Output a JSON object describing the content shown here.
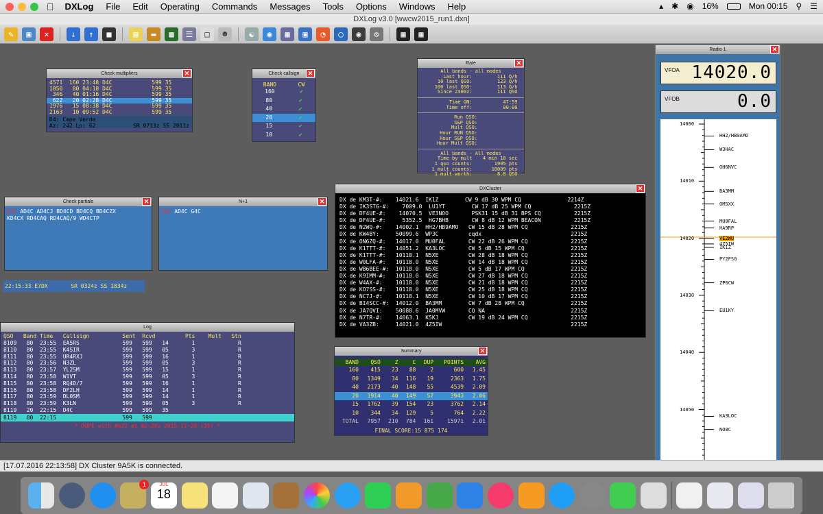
{
  "menubar": {
    "app": "DXLog",
    "items": [
      "File",
      "Edit",
      "Operating",
      "Commands",
      "Messages",
      "Tools",
      "Options",
      "Windows",
      "Help"
    ],
    "battery": "16%",
    "clock": "Mon 00:15"
  },
  "window": {
    "title": "DXLog v3.0 [wwcw2015_run1.dxn]"
  },
  "check_mult": {
    "title": "Check multipliers",
    "rows": [
      "4571  160 23:48 D4C            599 35",
      "1050   80 04:18 D4C            599 35",
      " 346   40 01:16 D4C            599 35",
      " 622   20 02:28 D4C            599 35",
      "1976   15 08:38 D4C            599 35",
      "2163   10 09:52 D4C            599 35"
    ],
    "info1": "D4: Cape Verde",
    "info2": "Az: 242  Lp: 62",
    "info3": "SR 0713z  SS 2011z"
  },
  "check_call": {
    "title": "Check callsign",
    "col_band": "BAND",
    "col_mode": "CW",
    "bands": [
      "160",
      "80",
      "40",
      "20",
      "15",
      "10"
    ]
  },
  "rate": {
    "title": "Rate",
    "lines1": [
      "All bands - all modes"
    ],
    "rows": [
      [
        "Last hour:",
        "111 Q/h"
      ],
      [
        "10 last QSO:",
        "123 Q/h"
      ],
      [
        "100 last QSO:",
        "113 Q/h"
      ],
      [
        "Since 2300z:",
        "111 QSO"
      ]
    ],
    "rows2": [
      [
        "Time ON:",
        "47:59"
      ],
      [
        "Time off:",
        "00:00"
      ]
    ],
    "rows3": [
      "Run QSO:",
      "S&P QSO:",
      "Mult QSO:",
      "Hour RUN QSO:",
      "Hour S&P QSO:",
      "Hour Mult QSO:"
    ],
    "header4": "All bands - All modes",
    "rows4": [
      [
        "Time by mult",
        "4 min 18 sec"
      ],
      [
        "1 qso counts:",
        "1995 pts"
      ],
      [
        "1 mult counts:",
        "18009 pts"
      ],
      [
        "1 mult worth:",
        "8.8 QSO"
      ]
    ]
  },
  "partials": {
    "title": "Check partials",
    "text_red": "D4C",
    "text1": " AD4C  AD4CJ  BD4CD  BD4CQ  BD4CZX",
    "text2": "KD4CX  RD4CAQ  RD4CAQ/9  WD4CTP"
  },
  "nplus1": {
    "title": "N+1",
    "text_red": "D4C",
    "text1": "  AD4C  G4C"
  },
  "infobar": "22:15:33 E7DX       SR 0324z SS 1834z",
  "dxcluster": {
    "title": "DXCluster",
    "rows": [
      "DX de KM3T-#:    14021.6  IK1Z        CW 9 dB 30 WPM CQ              2214Z",
      "DX de IK3STG-#:    7009.0  LU1YT        CW 17 dB 25 WPM CQ             2215Z",
      "DX de DF4UE-#:    14070.5  VE3NOO       PSK31 15 dB 31 BPS CQ          2215Z",
      "DX de DF4UE-#:     5352.5  HG7BHB       CW 8 dB 12 WPM BEACON          2215Z",
      "DX de N2WQ-#:    14002.1  HH2/HB9AMO   CW 15 dB 28 WPM CQ             2215Z",
      "DX de KW4BY:     50099.6  WP3C         cqdx                           2215Z",
      "DX de ON6ZQ-#:   14017.0  MU0FAL       CW 22 dB 26 WPM CQ             2215Z",
      "DX de K1TTT-#:   14051.2  KA3LOC       CW 5 dB 15 WPM CQ              2215Z",
      "DX de K1TTT-#:   10118.1  N5XE         CW 28 dB 18 WPM CQ             2215Z",
      "DX de W0LFA-#:   10118.0  N5XE         CW 14 dB 18 WPM CQ             2215Z",
      "DX de WB6BEE-#:  10118.0  N5XE         CW 5 dB 17 WPM CQ              2215Z",
      "DX de K9IMM-#:   10118.0  N5XE         CW 27 dB 18 WPM CQ             2215Z",
      "DX de W4AX-#:    10118.0  N5XE         CW 21 dB 18 WPM CQ             2215Z",
      "DX de KO7SS-#:   10118.0  N5XE         CW 25 dB 18 WPM CQ             2215Z",
      "DX de NC7J-#:    10118.1  N5XE         CW 10 dB 17 WPM CQ             2215Z",
      "DX de BI4SCC-#:  14012.0  BA3MM        CW 7 dB 28 WPM CQ              2215Z",
      "DX de JA7QVI:    50088.6  JA0MVW       CQ NA                          2215Z",
      "DX de N7TR-#:    14063.1  K5KJ         CW 19 dB 24 WPM CQ             2215Z",
      "DX de VA3ZB:     14021.0  4Z5IW                                       2215Z"
    ]
  },
  "log": {
    "title": "Log",
    "header": "QSO   Band Time   Callsign          Sent  Rcvd         Pts    Mult   Stn",
    "rows": [
      "8109   80  23:55  EA5RS             599   599   14       1             R",
      "8110   80  23:55  K4SIR             599   599   05       3             R",
      "8111   80  23:55  UR4RXJ            599   599   16       1             R",
      "8112   80  23:56  N3ZL              599   599   05       3             R",
      "8113   80  23:57  YL2SM             599   599   15       1             R",
      "8114   80  23:58  W1VT              599   599   05       3             R",
      "8115   80  23:58  RQ4D/7            599   599   16       1             R",
      "8116   80  23:58  DF2LH             599   599   14       1             R",
      "8117   80  23:59  DL0SM             599   599   14       1             R",
      "8118   80  23:59  K3LN              599   599   05       3             R",
      "8119   20  22:15  D4C               599   599   35"
    ],
    "entry": "8119   80  22:15                    599   599",
    "dupe": "* DUPE with #622 at 02:28z 2015-11-28 (35) *"
  },
  "summary": {
    "title": "Summary",
    "headers": [
      "BAND",
      "QSO",
      "Z",
      "C",
      "DUP",
      "POINTS",
      "AVG"
    ],
    "rows": [
      [
        "160",
        "415",
        "23",
        "88",
        "2",
        "600",
        "1.45"
      ],
      [
        "80",
        "1349",
        "34",
        "116",
        "19",
        "2363",
        "1.75"
      ],
      [
        "40",
        "2173",
        "40",
        "148",
        "55",
        "4539",
        "2.09"
      ],
      [
        "20",
        "1914",
        "40",
        "149",
        "57",
        "3943",
        "2.06"
      ],
      [
        "15",
        "1762",
        "39",
        "154",
        "23",
        "3762",
        "2.14"
      ],
      [
        "10",
        "344",
        "34",
        "129",
        "5",
        "764",
        "2.22"
      ],
      [
        "TOTAL",
        "7957",
        "210",
        "784",
        "161",
        "15971",
        "2.01"
      ]
    ],
    "final": "FINAL SCORE:15 875 174"
  },
  "radio": {
    "title": "Radio 1",
    "vfoa_label": "VFOA",
    "vfoa": "14020.0",
    "vfob_label": "VFOB",
    "vfob": "0.0",
    "freqs": [
      "14000",
      "14010",
      "14020",
      "14030",
      "14040",
      "14050"
    ],
    "calls": [
      "HH2/HB9AMO",
      "W3HAC",
      "OH6NVC",
      "BA3MM",
      "OM5XX",
      "MU0FAL",
      "HA9RP",
      "VE2WU",
      "4Z5IW",
      "IK1Z",
      "PY2FSG",
      "ZP6CW",
      "EU1KY",
      "KA3LOC",
      "NO8C"
    ]
  },
  "status": "[17.07.2016 22:13:58] DX Cluster 9A5K is connected.",
  "calendar": {
    "month": "JUL",
    "day": "18"
  }
}
